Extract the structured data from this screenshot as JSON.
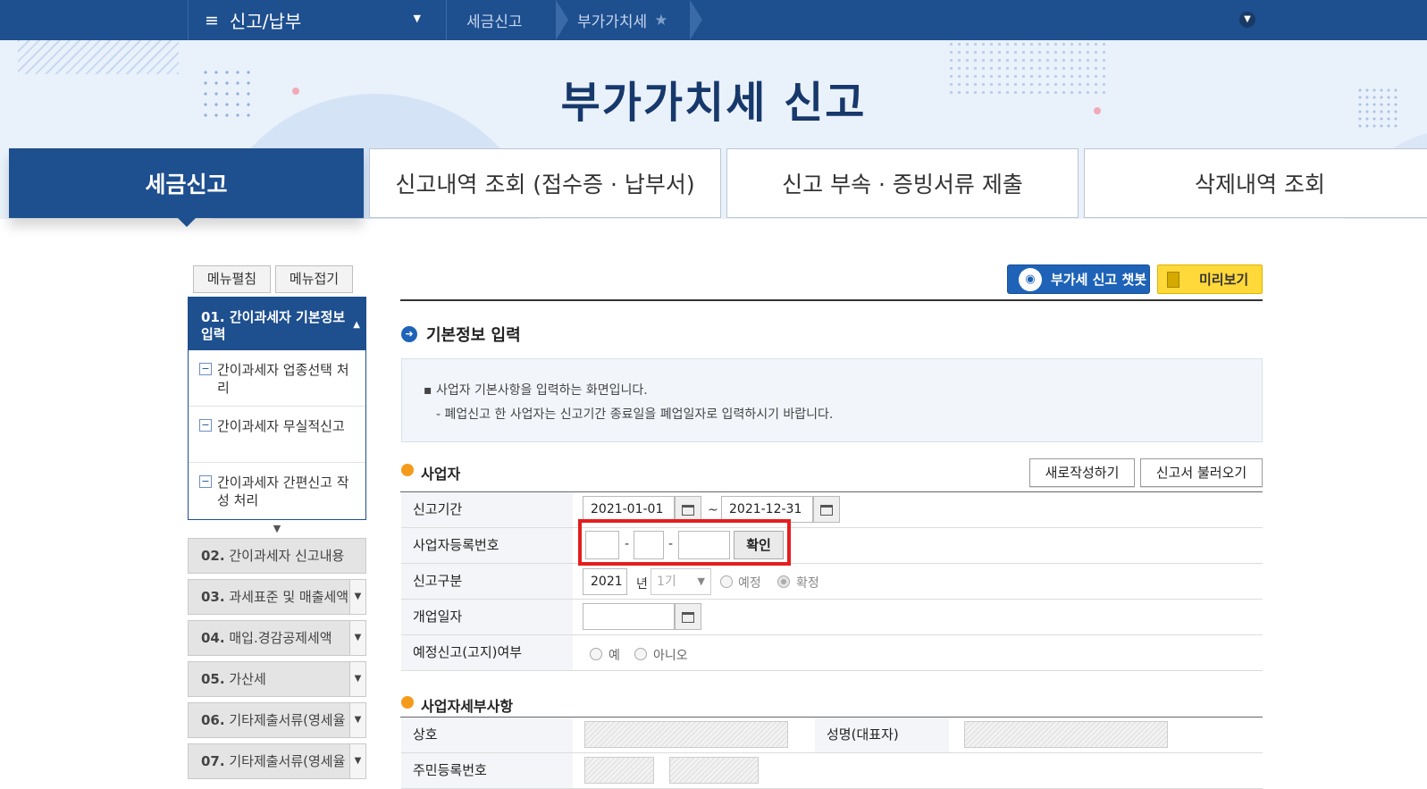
{
  "topnav": {
    "menu_icon": "hamburger-icon",
    "menu_label": "신고/납부",
    "crumbs": [
      "세금신고",
      "부가가치세"
    ]
  },
  "page_title": "부가가치세 신고",
  "tabs": [
    "세금신고",
    "신고내역 조회 (접수증 · 납부서)",
    "신고 부속 · 증빙서류 제출",
    "삭제내역 조회"
  ],
  "side_controls": {
    "expand": "메뉴펼침",
    "collapse": "메뉴접기"
  },
  "side_menu": {
    "active_num": "01.",
    "active_title": "간이과세자 기본정보 입력",
    "sub_items": [
      "간이과세자 업종선택 처리",
      "간이과세자 무실적신고",
      "간이과세자 간편신고 작성 처리"
    ],
    "sections": [
      {
        "num": "02.",
        "label": "간이과세자 신고내용"
      },
      {
        "num": "03.",
        "label": "과세표준 및 매출세액"
      },
      {
        "num": "04.",
        "label": "매입.경감공제세액"
      },
      {
        "num": "05.",
        "label": "가산세"
      },
      {
        "num": "06.",
        "label": "기타제출서류(영세율"
      },
      {
        "num": "07.",
        "label": "기타제출서류(영세율"
      }
    ]
  },
  "header_buttons": {
    "chatbot": "부가세 신고 챗봇",
    "preview": "미리보기"
  },
  "main": {
    "section_title": "기본정보 입력",
    "notice": [
      "▪ 사업자 기본사항을 입력하는 화면입니다.",
      "- 폐업신고 한 사업자는 신고기간 종료일을 폐업일자로 입력하시기 바랍니다."
    ],
    "business_section": "사업자",
    "new_button": "새로작성하기",
    "load_button": "신고서 불러오기",
    "fields": {
      "period_label": "신고기간",
      "period_start": "2021-01-01",
      "period_sep": "~",
      "period_end": "2021-12-31",
      "regno_label": "사업자등록번호",
      "regno_dash": "-",
      "confirm_button": "확인",
      "type_label": "신고구분",
      "type_year": "2021",
      "type_year_suffix": "년",
      "type_term": "1기",
      "type_opt1": "예정",
      "type_opt2": "확정",
      "opendate_label": "개업일자",
      "prelim_label": "예정신고(고지)여부",
      "prelim_yes": "예",
      "prelim_no": "아니오"
    },
    "detail_section": "사업자세부사항",
    "detail_fields": {
      "trade_name": "상호",
      "rep_name": "성명(대표자)",
      "resident_no": "주민등록번호"
    }
  }
}
